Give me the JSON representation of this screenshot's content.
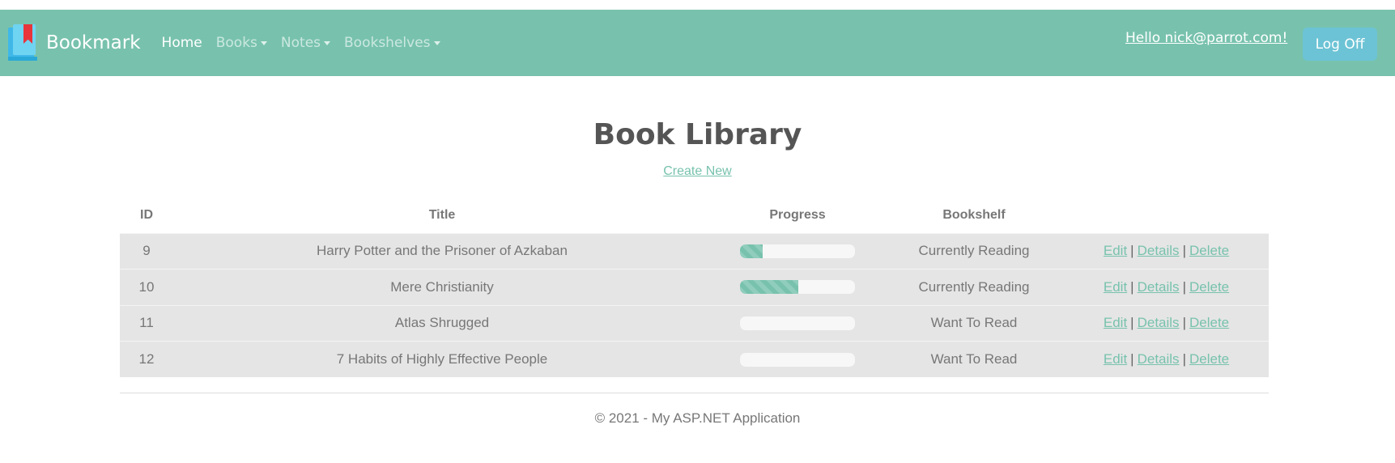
{
  "navbar": {
    "brand": "Bookmark",
    "items": [
      {
        "label": "Home",
        "active": true,
        "dropdown": false
      },
      {
        "label": "Books",
        "active": false,
        "dropdown": true
      },
      {
        "label": "Notes",
        "active": false,
        "dropdown": true
      },
      {
        "label": "Bookshelves",
        "active": false,
        "dropdown": true
      }
    ],
    "greeting": "Hello nick@parrot.com!",
    "logoff_label": "Log Off",
    "color": "#78c2ad"
  },
  "main": {
    "title": "Book Library",
    "create_new": "Create New"
  },
  "table": {
    "headers": [
      "ID",
      "Title",
      "Progress",
      "Bookshelf",
      ""
    ],
    "rows": [
      {
        "id": "9",
        "title": "Harry Potter and the Prisoner of Azkaban",
        "progress": 20,
        "bookshelf": "Currently Reading"
      },
      {
        "id": "10",
        "title": "Mere Christianity",
        "progress": 51,
        "bookshelf": "Currently Reading"
      },
      {
        "id": "11",
        "title": "Atlas Shrugged",
        "progress": 0,
        "bookshelf": "Want To Read"
      },
      {
        "id": "12",
        "title": "7 Habits of Highly Effective People",
        "progress": 0,
        "bookshelf": "Want To Read"
      }
    ],
    "actions": {
      "edit": "Edit",
      "details": "Details",
      "delete": "Delete",
      "separator": "|"
    }
  },
  "footer": {
    "text": "© 2021 - My ASP.NET Application"
  }
}
